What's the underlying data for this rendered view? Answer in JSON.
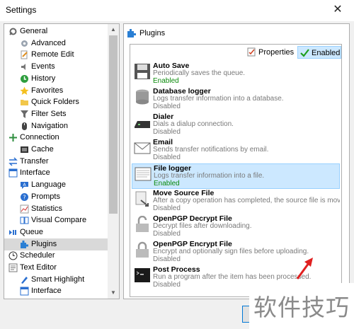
{
  "window": {
    "title": "Settings",
    "close_glyph": "✕"
  },
  "tree": {
    "items": [
      {
        "label": "General",
        "icon": "general-icon",
        "level": 0,
        "name": "general"
      },
      {
        "label": "Advanced",
        "icon": "gear-icon",
        "level": 1,
        "name": "advanced"
      },
      {
        "label": "Remote Edit",
        "icon": "document-edit-icon",
        "level": 1,
        "name": "remote-edit"
      },
      {
        "label": "Events",
        "icon": "sound-icon",
        "level": 1,
        "name": "events"
      },
      {
        "label": "History",
        "icon": "history-icon",
        "level": 1,
        "name": "history"
      },
      {
        "label": "Favorites",
        "icon": "star-icon",
        "level": 1,
        "name": "favorites"
      },
      {
        "label": "Quick Folders",
        "icon": "folder-icon",
        "level": 1,
        "name": "quick-folders"
      },
      {
        "label": "Filter Sets",
        "icon": "filter-icon",
        "level": 1,
        "name": "filter-sets"
      },
      {
        "label": "Navigation",
        "icon": "mouse-icon",
        "level": 1,
        "name": "navigation"
      },
      {
        "label": "Connection",
        "icon": "connection-icon",
        "level": 0,
        "name": "connection"
      },
      {
        "label": "Cache",
        "icon": "cache-icon",
        "level": 1,
        "name": "cache"
      },
      {
        "label": "Transfer",
        "icon": "transfer-icon",
        "level": 0,
        "name": "transfer"
      },
      {
        "label": "Interface",
        "icon": "interface-icon",
        "level": 0,
        "name": "interface"
      },
      {
        "label": "Language",
        "icon": "language-icon",
        "level": 1,
        "name": "language"
      },
      {
        "label": "Prompts",
        "icon": "question-icon",
        "level": 1,
        "name": "prompts"
      },
      {
        "label": "Statistics",
        "icon": "statistics-icon",
        "level": 1,
        "name": "statistics"
      },
      {
        "label": "Visual Compare",
        "icon": "compare-icon",
        "level": 1,
        "name": "visual-compare"
      },
      {
        "label": "Queue",
        "icon": "queue-icon",
        "level": 0,
        "name": "queue"
      },
      {
        "label": "Plugins",
        "icon": "plugin-icon",
        "level": 1,
        "name": "plugins",
        "selected": true
      },
      {
        "label": "Scheduler",
        "icon": "clock-icon",
        "level": 0,
        "name": "scheduler"
      },
      {
        "label": "Text Editor",
        "icon": "text-editor-icon",
        "level": 0,
        "name": "text-editor"
      },
      {
        "label": "Smart Highlight",
        "icon": "highlight-icon",
        "level": 1,
        "name": "smart-highlight"
      },
      {
        "label": "Interface",
        "icon": "interface-icon",
        "level": 1,
        "name": "text-editor-interface"
      }
    ]
  },
  "panel": {
    "title": "Plugins",
    "toolbar": {
      "properties_label": "Properties",
      "enabled_label": "Enabled"
    },
    "plugins": [
      {
        "name": "Auto Save",
        "desc": "Periodically saves the queue.",
        "status": "Enabled",
        "enabled": true,
        "icon": "floppy-icon",
        "id": "auto-save"
      },
      {
        "name": "Database logger",
        "desc": "Logs transfer information into a database.",
        "status": "Disabled",
        "enabled": false,
        "icon": "database-icon",
        "id": "database-logger"
      },
      {
        "name": "Dialer",
        "desc": "Dials a dialup connection.",
        "status": "Disabled",
        "enabled": false,
        "icon": "modem-icon",
        "id": "dialer"
      },
      {
        "name": "Email",
        "desc": "Sends transfer notifications by email.",
        "status": "Disabled",
        "enabled": false,
        "icon": "email-icon",
        "id": "email"
      },
      {
        "name": "File logger",
        "desc": "Logs transfer information into a file.",
        "status": "Enabled",
        "enabled": true,
        "icon": "log-file-icon",
        "id": "file-logger",
        "selected": true
      },
      {
        "name": "Move Source File",
        "desc": "After a copy operation has completed, the source file is moved...",
        "status": "Disabled",
        "enabled": false,
        "icon": "move-icon",
        "id": "move-source-file"
      },
      {
        "name": "OpenPGP Decrypt File",
        "desc": "Decrypt files after downloading.",
        "status": "Disabled",
        "enabled": false,
        "icon": "padlock-open-icon",
        "id": "openpgp-decrypt"
      },
      {
        "name": "OpenPGP Encrypt File",
        "desc": "Encrypt and optionally sign files before uploading.",
        "status": "Disabled",
        "enabled": false,
        "icon": "padlock-icon",
        "id": "openpgp-encrypt"
      },
      {
        "name": "Post Process",
        "desc": "Run a program after the item has been processed.",
        "status": "Disabled",
        "enabled": false,
        "icon": "console-icon",
        "id": "post-process"
      }
    ]
  },
  "watermark": {
    "text": "软件技巧"
  },
  "colors": {
    "enabled_green": "#0a8a0a",
    "selection_blue": "#cce8ff",
    "selection_border": "#99d1ff"
  }
}
